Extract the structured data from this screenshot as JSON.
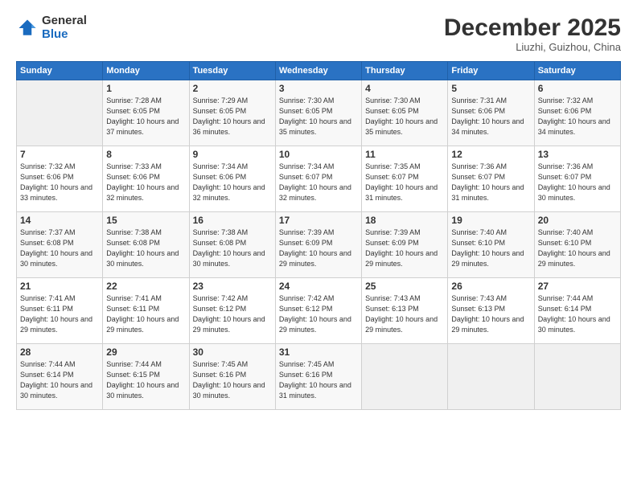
{
  "header": {
    "logo": {
      "general": "General",
      "blue": "Blue"
    },
    "title": "December 2025",
    "location": "Liuzhi, Guizhou, China"
  },
  "calendar": {
    "days_of_week": [
      "Sunday",
      "Monday",
      "Tuesday",
      "Wednesday",
      "Thursday",
      "Friday",
      "Saturday"
    ],
    "weeks": [
      [
        {
          "num": "",
          "empty": true
        },
        {
          "num": "1",
          "sunrise": "7:28 AM",
          "sunset": "6:05 PM",
          "daylight": "10 hours and 37 minutes."
        },
        {
          "num": "2",
          "sunrise": "7:29 AM",
          "sunset": "6:05 PM",
          "daylight": "10 hours and 36 minutes."
        },
        {
          "num": "3",
          "sunrise": "7:30 AM",
          "sunset": "6:05 PM",
          "daylight": "10 hours and 35 minutes."
        },
        {
          "num": "4",
          "sunrise": "7:30 AM",
          "sunset": "6:05 PM",
          "daylight": "10 hours and 35 minutes."
        },
        {
          "num": "5",
          "sunrise": "7:31 AM",
          "sunset": "6:06 PM",
          "daylight": "10 hours and 34 minutes."
        },
        {
          "num": "6",
          "sunrise": "7:32 AM",
          "sunset": "6:06 PM",
          "daylight": "10 hours and 34 minutes."
        }
      ],
      [
        {
          "num": "7",
          "sunrise": "7:32 AM",
          "sunset": "6:06 PM",
          "daylight": "10 hours and 33 minutes."
        },
        {
          "num": "8",
          "sunrise": "7:33 AM",
          "sunset": "6:06 PM",
          "daylight": "10 hours and 32 minutes."
        },
        {
          "num": "9",
          "sunrise": "7:34 AM",
          "sunset": "6:06 PM",
          "daylight": "10 hours and 32 minutes."
        },
        {
          "num": "10",
          "sunrise": "7:34 AM",
          "sunset": "6:07 PM",
          "daylight": "10 hours and 32 minutes."
        },
        {
          "num": "11",
          "sunrise": "7:35 AM",
          "sunset": "6:07 PM",
          "daylight": "10 hours and 31 minutes."
        },
        {
          "num": "12",
          "sunrise": "7:36 AM",
          "sunset": "6:07 PM",
          "daylight": "10 hours and 31 minutes."
        },
        {
          "num": "13",
          "sunrise": "7:36 AM",
          "sunset": "6:07 PM",
          "daylight": "10 hours and 30 minutes."
        }
      ],
      [
        {
          "num": "14",
          "sunrise": "7:37 AM",
          "sunset": "6:08 PM",
          "daylight": "10 hours and 30 minutes."
        },
        {
          "num": "15",
          "sunrise": "7:38 AM",
          "sunset": "6:08 PM",
          "daylight": "10 hours and 30 minutes."
        },
        {
          "num": "16",
          "sunrise": "7:38 AM",
          "sunset": "6:08 PM",
          "daylight": "10 hours and 30 minutes."
        },
        {
          "num": "17",
          "sunrise": "7:39 AM",
          "sunset": "6:09 PM",
          "daylight": "10 hours and 29 minutes."
        },
        {
          "num": "18",
          "sunrise": "7:39 AM",
          "sunset": "6:09 PM",
          "daylight": "10 hours and 29 minutes."
        },
        {
          "num": "19",
          "sunrise": "7:40 AM",
          "sunset": "6:10 PM",
          "daylight": "10 hours and 29 minutes."
        },
        {
          "num": "20",
          "sunrise": "7:40 AM",
          "sunset": "6:10 PM",
          "daylight": "10 hours and 29 minutes."
        }
      ],
      [
        {
          "num": "21",
          "sunrise": "7:41 AM",
          "sunset": "6:11 PM",
          "daylight": "10 hours and 29 minutes."
        },
        {
          "num": "22",
          "sunrise": "7:41 AM",
          "sunset": "6:11 PM",
          "daylight": "10 hours and 29 minutes."
        },
        {
          "num": "23",
          "sunrise": "7:42 AM",
          "sunset": "6:12 PM",
          "daylight": "10 hours and 29 minutes."
        },
        {
          "num": "24",
          "sunrise": "7:42 AM",
          "sunset": "6:12 PM",
          "daylight": "10 hours and 29 minutes."
        },
        {
          "num": "25",
          "sunrise": "7:43 AM",
          "sunset": "6:13 PM",
          "daylight": "10 hours and 29 minutes."
        },
        {
          "num": "26",
          "sunrise": "7:43 AM",
          "sunset": "6:13 PM",
          "daylight": "10 hours and 29 minutes."
        },
        {
          "num": "27",
          "sunrise": "7:44 AM",
          "sunset": "6:14 PM",
          "daylight": "10 hours and 30 minutes."
        }
      ],
      [
        {
          "num": "28",
          "sunrise": "7:44 AM",
          "sunset": "6:14 PM",
          "daylight": "10 hours and 30 minutes."
        },
        {
          "num": "29",
          "sunrise": "7:44 AM",
          "sunset": "6:15 PM",
          "daylight": "10 hours and 30 minutes."
        },
        {
          "num": "30",
          "sunrise": "7:45 AM",
          "sunset": "6:16 PM",
          "daylight": "10 hours and 30 minutes."
        },
        {
          "num": "31",
          "sunrise": "7:45 AM",
          "sunset": "6:16 PM",
          "daylight": "10 hours and 31 minutes."
        },
        {
          "num": "",
          "empty": true
        },
        {
          "num": "",
          "empty": true
        },
        {
          "num": "",
          "empty": true
        }
      ]
    ]
  }
}
